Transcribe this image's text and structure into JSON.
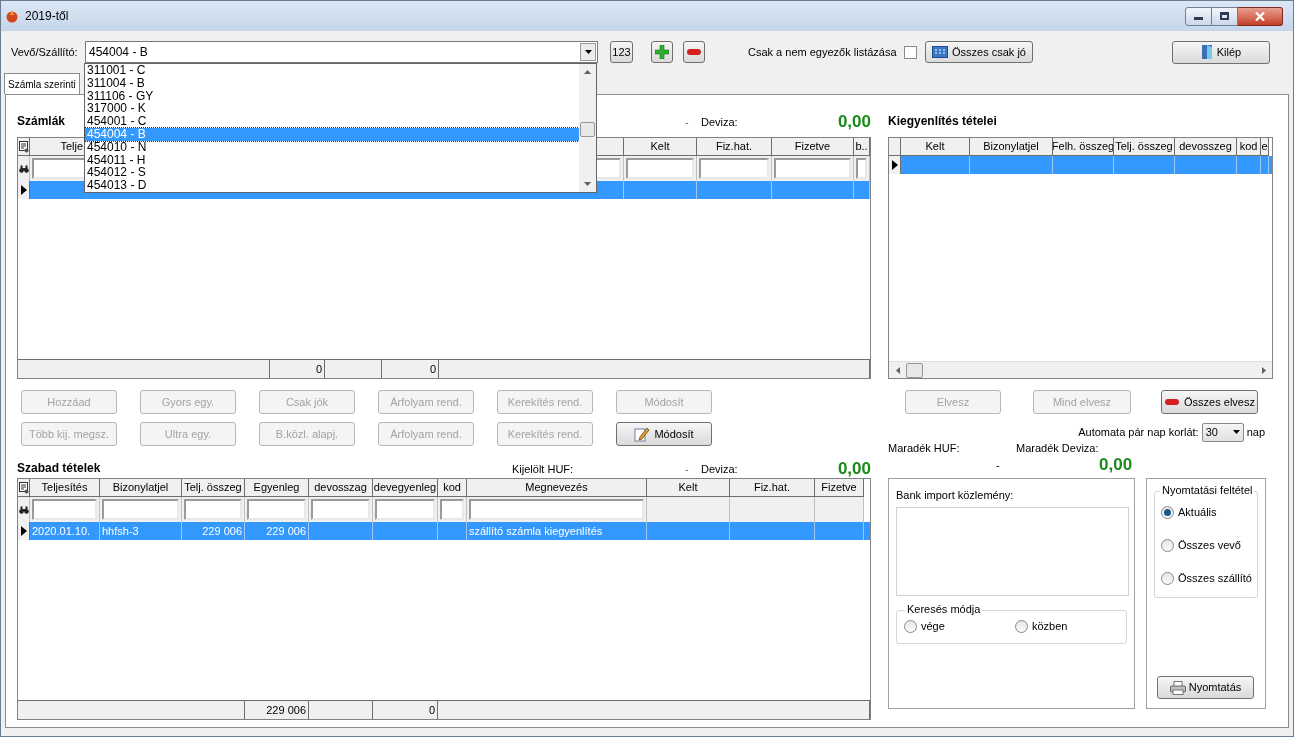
{
  "window": {
    "title": "2019-től"
  },
  "toolbar": {
    "customer_label": "Vevő/Szállító:",
    "customer_value": "454004 - B",
    "number_button": "123",
    "filter_label": "Csak a nem egyezők listázása",
    "filter_checked": false,
    "all_ok_button": "Összes csak jó",
    "exit_button": "Kilép"
  },
  "customer_dropdown": [
    {
      "label": "311001 - C",
      "selected": false
    },
    {
      "label": "311004 - B",
      "selected": false
    },
    {
      "label": "311106 - GY",
      "selected": false
    },
    {
      "label": "317000 - K",
      "selected": false
    },
    {
      "label": "454001 - C",
      "selected": false
    },
    {
      "label": "454004 - B",
      "selected": true
    },
    {
      "label": "454010 - N",
      "selected": false
    },
    {
      "label": "454011 - H",
      "selected": false
    },
    {
      "label": "454012 - S",
      "selected": false
    },
    {
      "label": "454013 - D",
      "selected": false
    }
  ],
  "tabs": [
    {
      "label": "Számla szerinti",
      "selected": true
    }
  ],
  "invoices": {
    "title": "Számlák",
    "dash": "-",
    "deviza_label": "Deviza:",
    "deviza_value": "0,00",
    "columns": [
      {
        "label": "Telje",
        "filter": true
      },
      {
        "label": "Kelt",
        "filter": true
      },
      {
        "label": "Fiz.hat.",
        "filter": true
      },
      {
        "label": "Fizetve",
        "filter": true
      },
      {
        "label": "b..",
        "filter": true
      }
    ],
    "rows": [
      {
        "selected": true,
        "cells": [
          {},
          {},
          {},
          {},
          {}
        ]
      }
    ],
    "footer": [
      "0",
      "0"
    ]
  },
  "invoice_buttons": [
    [
      {
        "label": "Hozzáad",
        "disabled": true,
        "kind": "plain"
      },
      {
        "label": "Gyors egy.",
        "disabled": true,
        "kind": "plain"
      },
      {
        "label": "Csak jók",
        "disabled": true,
        "kind": "plain"
      },
      {
        "label": "Árfolyam rend.",
        "disabled": true,
        "kind": "plain"
      },
      {
        "label": "Kerekítés rend.",
        "disabled": true,
        "kind": "plain"
      },
      {
        "label": "Módosít",
        "disabled": true,
        "kind": "plain"
      }
    ],
    [
      {
        "label": "Több kij. megsz.",
        "disabled": true,
        "kind": "plain"
      },
      {
        "label": "Ultra egy.",
        "disabled": true,
        "kind": "plain"
      },
      {
        "label": "B.közl. alapj.",
        "disabled": true,
        "kind": "plain"
      },
      {
        "label": "Árfolyam rend.",
        "disabled": true,
        "kind": "plain"
      },
      {
        "label": "Kerekítés rend.",
        "disabled": true,
        "kind": "plain"
      },
      {
        "label": "Módosít",
        "disabled": false,
        "kind": "edit"
      }
    ]
  ],
  "free_items": {
    "title": "Szabad tételek",
    "selected_label": "Kijelölt HUF:",
    "dash": "-",
    "deviza_label": "Deviza:",
    "deviza_value": "0,00",
    "columns": [
      {
        "label": "Teljesítés",
        "filter": true,
        "kind": "text"
      },
      {
        "label": "Bizonylatjel",
        "filter": true,
        "kind": "text"
      },
      {
        "label": "Telj. összeg",
        "filter": true,
        "kind": "amount"
      },
      {
        "label": "Egyenleg",
        "filter": true,
        "kind": "amount"
      },
      {
        "label": "devosszag",
        "filter": true,
        "kind": "amount"
      },
      {
        "label": "devegyenleg",
        "filter": true,
        "kind": "amount"
      },
      {
        "label": "kod",
        "filter": true,
        "kind": "text"
      },
      {
        "label": "Megnevezés",
        "filter": true,
        "kind": "text"
      },
      {
        "label": "Kelt",
        "filter": false,
        "kind": "text"
      },
      {
        "label": "Fiz.hat.",
        "filter": false,
        "kind": "text"
      },
      {
        "label": "Fizetve",
        "filter": false,
        "kind": "amount"
      }
    ],
    "rows": [
      {
        "selected": true,
        "cells": [
          {
            "text": "2020.01.10."
          },
          {
            "text": "hhfsh-3"
          },
          {
            "text": "229 006"
          },
          {
            "text": "229 006"
          },
          {},
          {},
          {},
          {
            "text": "szállító számla kiegyenlítés"
          },
          {},
          {},
          {}
        ]
      }
    ],
    "footer": [
      "229 006",
      "0"
    ]
  },
  "settlement": {
    "title": "Kiegyenlítés tételei",
    "columns": [
      {
        "label": "Kelt"
      },
      {
        "label": "Bizonylatjel"
      },
      {
        "label": "Felh. összeg"
      },
      {
        "label": "Telj. összeg"
      },
      {
        "label": "devosszeg"
      },
      {
        "label": "kod"
      },
      {
        "label": "e"
      }
    ],
    "rows": [
      {
        "selected": true,
        "cells": [
          {},
          {},
          {},
          {},
          {},
          {},
          {}
        ]
      }
    ]
  },
  "settlement_buttons": [
    {
      "label": "Elvesz",
      "disabled": true,
      "kind": "plain"
    },
    {
      "label": "Mind elvesz",
      "disabled": true,
      "kind": "plain"
    },
    {
      "label": "Összes elvesz",
      "disabled": false,
      "kind": "remove"
    }
  ],
  "auto_pair": {
    "label": "Automata pár nap korlát:",
    "value": "30",
    "unit": "nap"
  },
  "remainder": {
    "huf_label": "Maradék HUF:",
    "deviza_label": "Maradék Deviza:",
    "huf_value": "-",
    "deviza_value": "0,00"
  },
  "bank_import": {
    "label": "Bank import közlemény:",
    "search_mode": {
      "title": "Keresés módja",
      "options": [
        {
          "label": "vége",
          "selected": false
        },
        {
          "label": "közben",
          "selected": false
        }
      ]
    }
  },
  "print": {
    "title": "Nyomtatási feltétel",
    "options": [
      {
        "label": "Aktuális",
        "selected": true
      },
      {
        "label": "Összes vevő",
        "selected": false
      },
      {
        "label": "Összes szállító",
        "selected": false
      }
    ],
    "button": "Nyomtatás"
  }
}
